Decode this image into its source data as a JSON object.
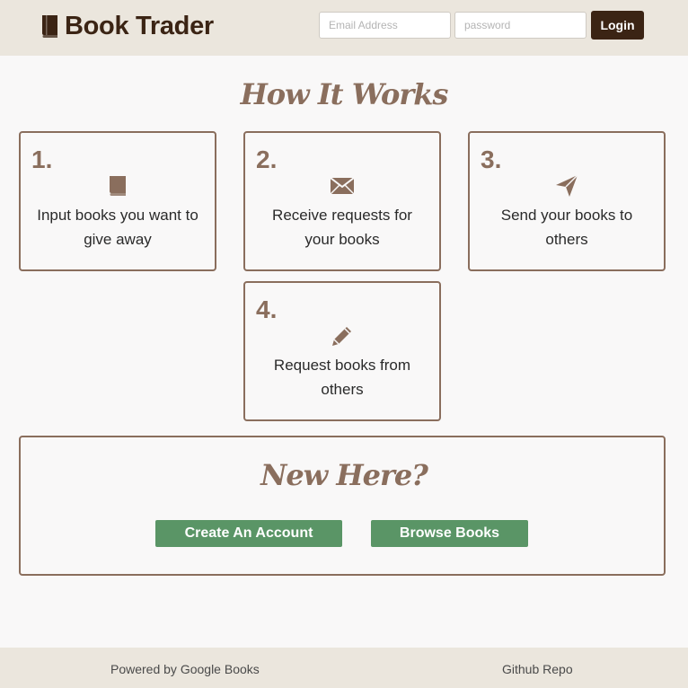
{
  "nav": {
    "brand": "Book Trader",
    "email_placeholder": "Email Address",
    "password_placeholder": "password",
    "login_label": "Login"
  },
  "how": {
    "title": "How It Works",
    "steps": [
      {
        "number": "1.",
        "icon": "book-icon",
        "text": "Input books you want to give away"
      },
      {
        "number": "2.",
        "icon": "envelope-icon",
        "text": "Receive requests for your books"
      },
      {
        "number": "3.",
        "icon": "paper-plane-icon",
        "text": "Send your books to others"
      },
      {
        "number": "4.",
        "icon": "pencil-icon",
        "text": "Request books from others"
      }
    ]
  },
  "new_here": {
    "title": "New Here?",
    "create_label": "Create An Account",
    "browse_label": "Browse Books"
  },
  "footer": {
    "powered": "Powered by Google Books",
    "repo": "Github Repo"
  },
  "colors": {
    "navbar_bg": "#ebe6dd",
    "brand": "#3b2414",
    "accent": "#8a6e5d",
    "button_green": "#5a9566",
    "page_bg": "#f9f8f8"
  }
}
